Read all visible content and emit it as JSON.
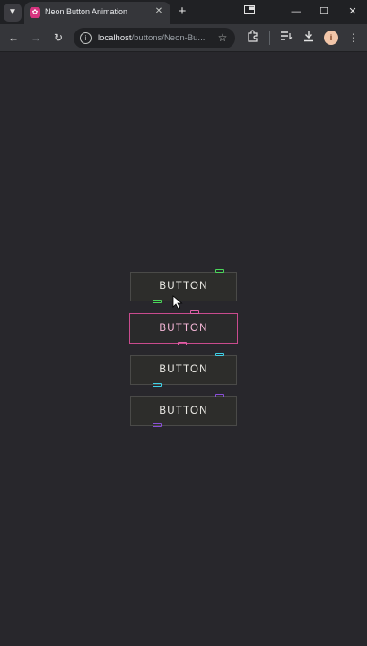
{
  "browser": {
    "tab_title": "Neon Button Animation",
    "favicon_glyph": "✿",
    "url_host": "localhost",
    "url_path": "/buttons/Neon-Bu...",
    "profile_initial": "i",
    "icons": [
      "tab-search-icon",
      "close-icon",
      "plus-icon",
      "minimize-icon",
      "maximize-icon",
      "close-window-icon",
      "back-arrow-icon",
      "forward-arrow-icon",
      "reload-icon",
      "site-info-icon",
      "star-icon",
      "extensions-icon",
      "reading-list-icon",
      "download-icon"
    ]
  },
  "page": {
    "buttons": [
      {
        "label": "BUTTON",
        "accent": "#4bd65a"
      },
      {
        "label": "BUTTON",
        "accent": "#e060a8"
      },
      {
        "label": "BUTTON",
        "accent": "#3fd0e6"
      },
      {
        "label": "BUTTON",
        "accent": "#8a4fd8"
      }
    ]
  }
}
